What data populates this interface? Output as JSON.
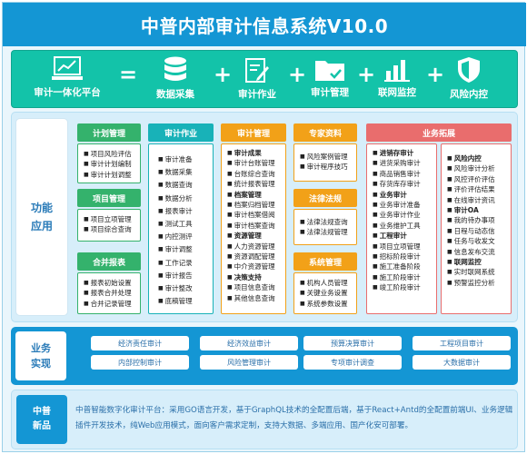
{
  "title": "中普内部审计信息系统V10.0",
  "equation": {
    "result": "审计一体化平台",
    "equals": "=",
    "plus": "+",
    "terms": [
      "数据采集",
      "审计作业",
      "审计管理",
      "联网监控",
      "风险内控"
    ],
    "icons": [
      "computer-chart-icon",
      "database-icon",
      "clipboard-edit-icon",
      "folder-check-icon",
      "bar-chart-icon",
      "shield-icon"
    ]
  },
  "function_section": {
    "label": "功能应用",
    "plan": {
      "header": "计划管理",
      "items": [
        "项目风险评估",
        "审计计划编制",
        "审计计划调整"
      ]
    },
    "project": {
      "header": "项目管理",
      "items": [
        "项目立项管理",
        "项目综合查询"
      ]
    },
    "merge": {
      "header": "合并报表",
      "items": [
        "报表初始设置",
        "报表合并处理",
        "合并记录管理"
      ]
    },
    "work": {
      "header": "审计作业",
      "items": [
        "审计准备",
        "数据采集",
        "数据查询",
        "数据分析",
        "报表审计",
        "测试工具",
        "内控测评",
        "审计调整",
        "工作记录",
        "审计报告",
        "审计整改",
        "底稿管理"
      ]
    },
    "mgmt": {
      "header": "审计管理",
      "groups": [
        {
          "title": "审计成果",
          "items": [
            "审计台账管理",
            "台账综合查询",
            "统计报表管理"
          ]
        },
        {
          "title": "档案管理",
          "items": [
            "档案归档管理",
            "审计档案借阅",
            "审计档案查询"
          ]
        },
        {
          "title": "资源管理",
          "items": [
            "人力资源管理",
            "资源调配管理",
            "中介资源管理"
          ]
        },
        {
          "title": "决策支持",
          "items": [
            "项目信息查询",
            "其他信息查询"
          ]
        }
      ]
    },
    "expert": {
      "header": "专家资料",
      "items": [
        "风险案例管理",
        "审计程序技巧"
      ]
    },
    "law": {
      "header": "法律法规",
      "items": [
        "法律法规查询",
        "法律法规管理"
      ]
    },
    "system": {
      "header": "系统管理",
      "items": [
        "机构人员管理",
        "关键业务设置",
        "系统参数设置"
      ]
    },
    "expand": {
      "header": "业务拓展",
      "left": [
        {
          "title": "进销存审计",
          "items": [
            "进货采购审计",
            "商品销售审计",
            "存货库存审计"
          ]
        },
        {
          "title": "业务审计",
          "items": [
            "业务审计准备",
            "业务审计作业",
            "业务维护工具"
          ]
        },
        {
          "title": "工程审计",
          "items": [
            "项目立项管理",
            "招标阶段审计",
            "施工准备阶段",
            "施工阶段审计",
            "竣工阶段审计"
          ]
        }
      ],
      "right": [
        {
          "title": "风险内控",
          "items": [
            "风险审计分析",
            "风控评价评估",
            "评价评估结果",
            "在线审计资讯"
          ]
        },
        {
          "title": "审计OA",
          "items": [
            "我的待办事项",
            "日程与动态信",
            "任务与收发文",
            "信息发布交流"
          ]
        },
        {
          "title": "联网监控",
          "items": [
            "实时联网系统",
            "预警监控分析"
          ]
        }
      ]
    }
  },
  "business_section": {
    "label": "业务实现",
    "items": [
      "经济责任审计",
      "经济效益审计",
      "预算决算审计",
      "工程项目审计",
      "内部控制审计",
      "风险管理审计",
      "专项审计调查",
      "大数据审计"
    ]
  },
  "new_section": {
    "label": "中普新品",
    "text": "中普智能数字化审计平台：采用GO语言开发，基于GraphQL技术的全配置后端，基于React+Antd的全配置前端UI、业务逻辑插件开发技术，纯Web应用模式，面向客户需求定制，支持大数据、多端应用、国产化安可部署。"
  },
  "colors": {
    "title_bar": "#1496d4",
    "equation_band": "#13c3a9",
    "green": "#34b26c",
    "teal": "#18b2b8",
    "orange": "#f2a118",
    "red": "#e96d6d",
    "text_blue": "#2a6fa8"
  }
}
